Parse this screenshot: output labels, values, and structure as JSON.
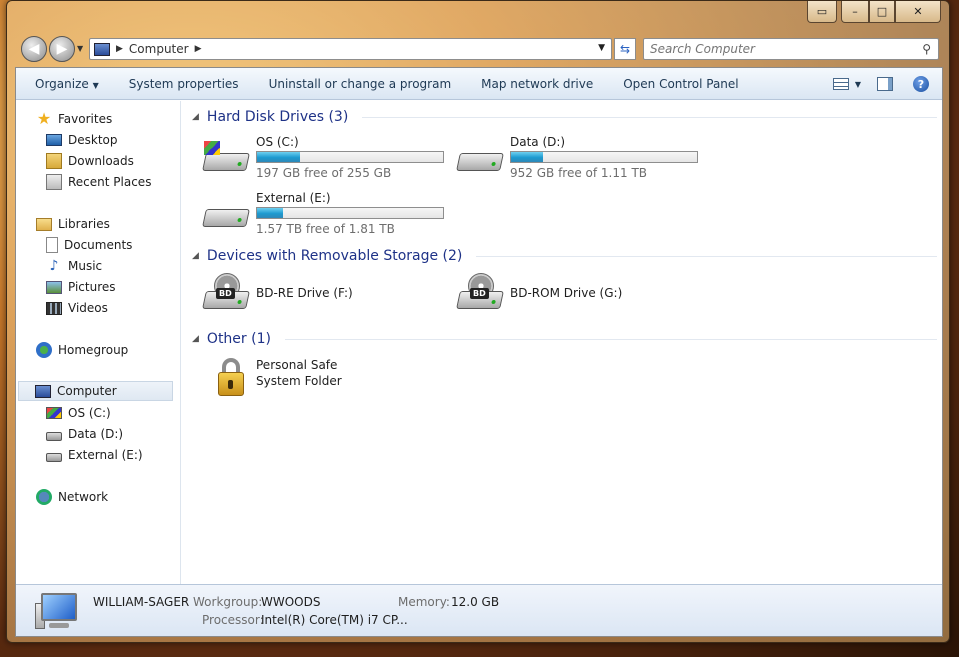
{
  "window": {
    "caption_buttons": {
      "minimize": "–",
      "maximize": "□",
      "close": "✕"
    }
  },
  "address_bar": {
    "path": [
      "Computer"
    ],
    "search_placeholder": "Search Computer"
  },
  "command_bar": {
    "items": [
      "Organize",
      "System properties",
      "Uninstall or change a program",
      "Map network drive",
      "Open Control Panel"
    ],
    "organize_arrow": "▼"
  },
  "nav_pane": {
    "favorites": {
      "label": "Favorites",
      "items": [
        "Desktop",
        "Downloads",
        "Recent Places"
      ]
    },
    "libraries": {
      "label": "Libraries",
      "items": [
        "Documents",
        "Music",
        "Pictures",
        "Videos"
      ]
    },
    "homegroup": "Homegroup",
    "computer": {
      "label": "Computer",
      "items": [
        "OS (C:)",
        "Data (D:)",
        "External (E:)"
      ]
    },
    "network": "Network"
  },
  "groups": {
    "hdd": {
      "title": "Hard Disk Drives (3)",
      "drives": [
        {
          "name": "OS (C:)",
          "free_text": "197 GB free of 255 GB",
          "used_fraction": 0.23
        },
        {
          "name": "Data (D:)",
          "free_text": "952 GB free of 1.11 TB",
          "used_fraction": 0.17
        },
        {
          "name": "External (E:)",
          "free_text": "1.57 TB free of 1.81 TB",
          "used_fraction": 0.14
        }
      ]
    },
    "removable": {
      "title": "Devices with Removable Storage (2)",
      "devices": [
        {
          "name": "BD-RE Drive (F:)",
          "badge": "BD"
        },
        {
          "name": "BD-ROM Drive (G:)",
          "badge": "BD"
        }
      ]
    },
    "other": {
      "title": "Other (1)",
      "items": [
        {
          "name": "Personal Safe",
          "type": "System Folder"
        }
      ]
    }
  },
  "details": {
    "computer_name": "WILLIAM-SAGER",
    "workgroup_label": "Workgroup:",
    "workgroup": "WWOODS",
    "memory_label": "Memory:",
    "memory": "12.0 GB",
    "processor_label": "Processor:",
    "processor": "Intel(R) Core(TM) i7 CP..."
  }
}
